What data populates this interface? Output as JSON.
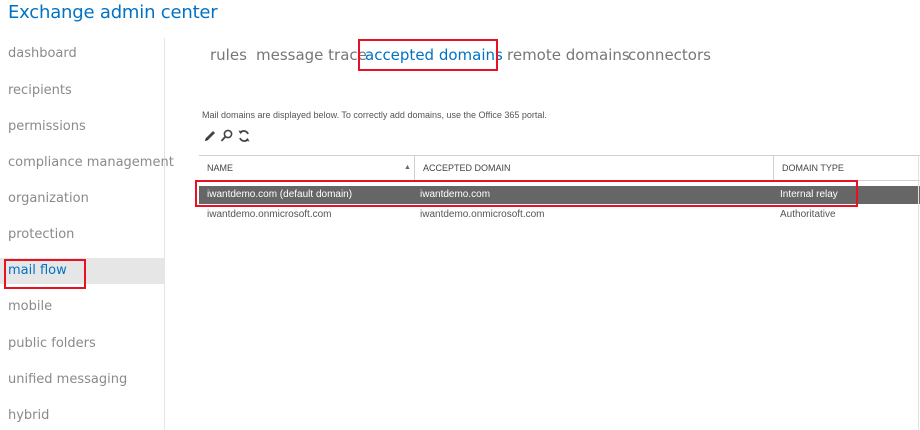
{
  "header": {
    "title": "Exchange admin center"
  },
  "sidebar": {
    "items": [
      {
        "label": "dashboard"
      },
      {
        "label": "recipients"
      },
      {
        "label": "permissions"
      },
      {
        "label": "compliance management"
      },
      {
        "label": "organization"
      },
      {
        "label": "protection"
      },
      {
        "label": "mail flow"
      },
      {
        "label": "mobile"
      },
      {
        "label": "public folders"
      },
      {
        "label": "unified messaging"
      },
      {
        "label": "hybrid"
      }
    ],
    "active": "mail flow"
  },
  "tabs": [
    {
      "label": "rules"
    },
    {
      "label": "message trace"
    },
    {
      "label": "accepted domains"
    },
    {
      "label": "remote domains"
    },
    {
      "label": "connectors"
    }
  ],
  "active_tab": "accepted domains",
  "main": {
    "info_text": "Mail domains are displayed below. To correctly add domains, use the Office 365 portal.",
    "toolbar": [
      "edit-icon",
      "search-icon",
      "refresh-icon"
    ]
  },
  "table": {
    "columns": [
      "NAME",
      "ACCEPTED DOMAIN",
      "DOMAIN TYPE"
    ],
    "sort_column": "NAME",
    "sort_direction": "ascending",
    "rows": [
      {
        "name": "iwantdemo.com (default domain)",
        "accepted_domain": "iwantdemo.com",
        "domain_type": "Internal relay",
        "selected": true
      },
      {
        "name": "iwantdemo.onmicrosoft.com",
        "accepted_domain": "iwantdemo.onmicrosoft.com",
        "domain_type": "Authoritative",
        "selected": false
      }
    ]
  },
  "colors": {
    "accent": "#0072c6",
    "highlight_box": "#e81123",
    "selected_row": "#666666",
    "nav_active_bg": "#e6e6e6"
  }
}
